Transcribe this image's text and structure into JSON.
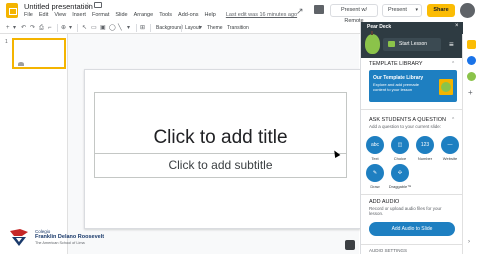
{
  "header": {
    "doc_title": "Untitled presentation",
    "menu": [
      "File",
      "Edit",
      "View",
      "Insert",
      "Format",
      "Slide",
      "Arrange",
      "Tools",
      "Add-ons",
      "Help"
    ],
    "last_edit": "Last edit was 16 minutes ago",
    "present_remote": "Present w/ Remote",
    "present": "Present",
    "share": "Share"
  },
  "toolbar": {
    "add_icon": "+",
    "background": "Background",
    "layout": "Layout",
    "theme": "Theme",
    "transition": "Transition"
  },
  "filmstrip": {
    "slide_number": "1"
  },
  "logo": {
    "line1": "Colegio",
    "line2": "Franklin Delano Roosevelt",
    "line3": "The American School of Lima"
  },
  "slide": {
    "title_placeholder": "Click to add title",
    "subtitle_placeholder": "Click to add subtitle"
  },
  "peardeck": {
    "title": "Pear Deck",
    "start_lesson": "Start Lesson",
    "template_library": "TEMPLATE LIBRARY",
    "library_card_title": "Our Template Library",
    "library_card_desc": "Explore and add premade content to your lesson",
    "ask_question": "ASK STUDENTS A QUESTION",
    "ask_sub": "Add a question to your current slide:",
    "question_types": [
      {
        "icon": "abc",
        "label": "Text"
      },
      {
        "icon": "◫",
        "label": "Choice"
      },
      {
        "icon": "123",
        "label": "Number"
      },
      {
        "icon": "—",
        "label": "Website"
      },
      {
        "icon": "✎",
        "label": "Draw"
      },
      {
        "icon": "✣",
        "label": "Draggable™"
      }
    ],
    "add_audio": "ADD AUDIO",
    "audio_sub": "Record or upload audio files for your lesson.",
    "audio_button": "Add Audio to Slide",
    "more": "AUDIO SETTINGS"
  },
  "colors": {
    "accent_yellow": "#f4b400",
    "peardeck_blue": "#1e7fc1",
    "peardeck_header": "#2e3b42"
  }
}
